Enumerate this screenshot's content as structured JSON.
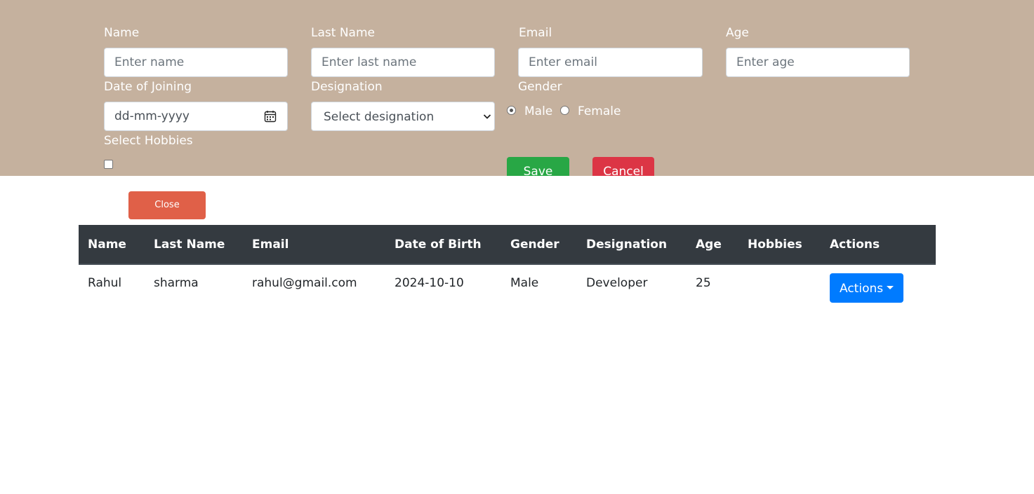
{
  "form": {
    "name_label": "Name",
    "name_placeholder": "Enter name",
    "last_name_label": "Last Name",
    "last_name_placeholder": "Enter last name",
    "email_label": "Email",
    "email_placeholder": "Enter email",
    "age_label": "Age",
    "age_placeholder": "Enter age",
    "doj_label": "Date of Joining",
    "doj_placeholder": "dd-mm-yyyy",
    "designation_label": "Designation",
    "designation_selected": "Select designation",
    "gender_label": "Gender",
    "gender_options": [
      "Male",
      "Female"
    ],
    "gender_selected": "Male",
    "hobbies_label": "Select Hobbies",
    "save_label": "Save",
    "cancel_label": "Cancel",
    "panel_color": "#c5b19e"
  },
  "close_label": "Close",
  "table": {
    "headers": [
      "Name",
      "Last Name",
      "Email",
      "Date of Birth",
      "Gender",
      "Designation",
      "Age",
      "Hobbies",
      "Actions"
    ],
    "rows": [
      {
        "name": "Rahul",
        "last_name": "sharma",
        "email": "rahul@gmail.com",
        "dob": "2024-10-10",
        "gender": "Male",
        "designation": "Developer",
        "age": "25",
        "hobbies": "",
        "actions_label": "Actions"
      }
    ]
  },
  "icons": [
    "calendar-icon",
    "chevron-down-icon",
    "caret-down-icon"
  ],
  "colors": {
    "save": "#28a745",
    "cancel": "#dc3545",
    "close": "#e06048",
    "actions": "#007bff",
    "table_header": "#343a40"
  }
}
